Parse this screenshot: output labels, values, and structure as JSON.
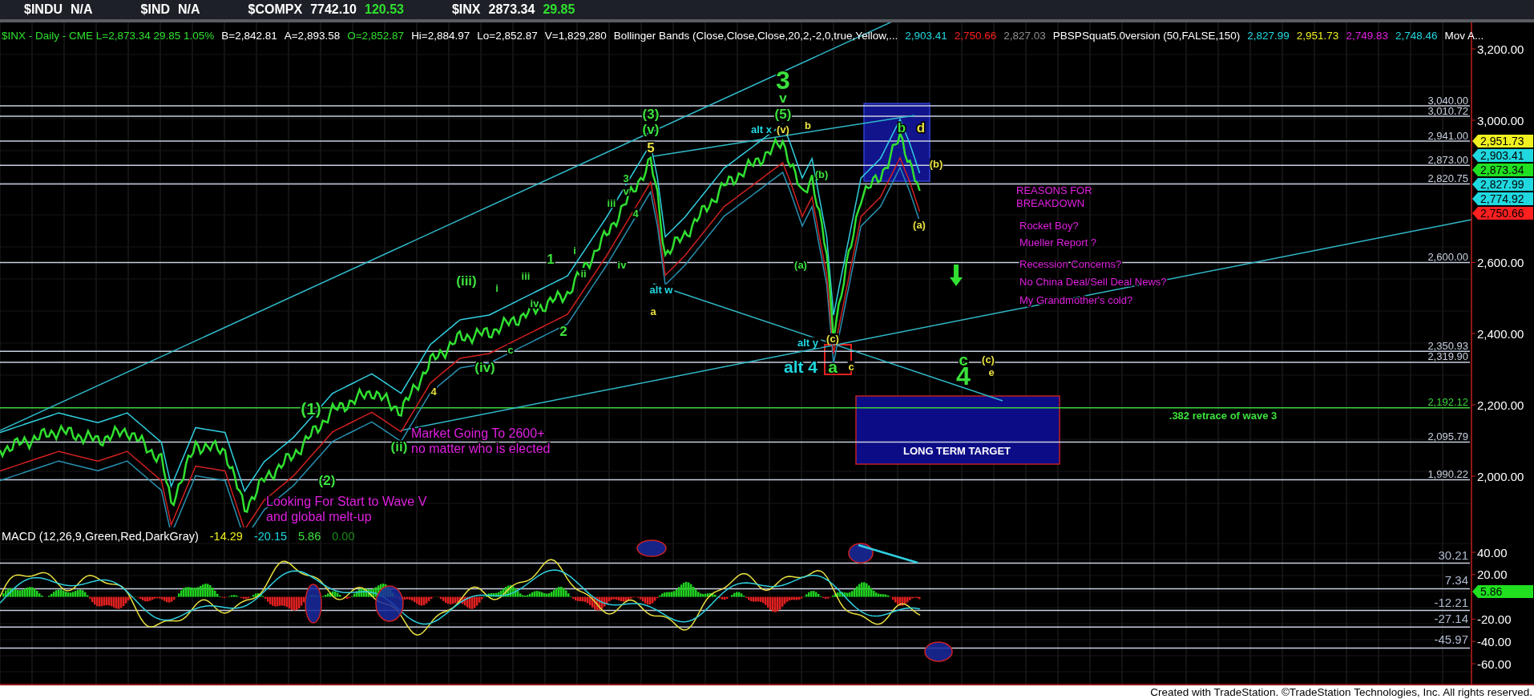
{
  "quote_strip": [
    {
      "symbol": "$INDU",
      "last": "N/A"
    },
    {
      "symbol": "$IND",
      "last": "N/A"
    },
    {
      "symbol": "$COMPX",
      "last": "7742.10",
      "change": "120.53"
    },
    {
      "symbol": "$INX",
      "last": "2873.34",
      "change": "29.85"
    }
  ],
  "price_panel": {
    "header": [
      {
        "text": "$INX - Daily - CME  L=2,873.34  29.85  1.05%",
        "color": "#2fe02f"
      },
      {
        "text": "B=2,842.81",
        "color": "#ffffff"
      },
      {
        "text": "A=2,893.58",
        "color": "#ffffff"
      },
      {
        "text": "O=2,852.87",
        "color": "#2fe02f"
      },
      {
        "text": "Hi=2,884.97",
        "color": "#ffffff"
      },
      {
        "text": "Lo=2,852.87",
        "color": "#ffffff"
      },
      {
        "text": "V=1,829,280",
        "color": "#ffffff"
      },
      {
        "text": "Bollinger Bands (Close,Close,Close,20,2,-2,0,true,Yellow,...",
        "color": "#ffffff"
      },
      {
        "text": "2,903.41",
        "color": "#20d8e0"
      },
      {
        "text": "2,750.66",
        "color": "#ff2020"
      },
      {
        "text": "2,827.03",
        "color": "#909090"
      },
      {
        "text": "PBSPSquat5.0version (50,FALSE,150)",
        "color": "#ffffff"
      },
      {
        "text": "2,827.99",
        "color": "#20d8e0"
      },
      {
        "text": "2,951.73",
        "color": "#f0f020"
      },
      {
        "text": "2,749.83",
        "color": "#e020e0"
      },
      {
        "text": "2,748.46",
        "color": "#20d8e0"
      },
      {
        "text": "Mov A...",
        "color": "#ffffff"
      }
    ],
    "axis_ticks": [
      "3,200.00",
      "3,000.00",
      "2,600.00",
      "2,400.00",
      "2,200.00",
      "2,000.00"
    ],
    "levels": [
      {
        "label": "3,040.00",
        "color": "#c8d0e0"
      },
      {
        "label": "3,010.72",
        "color": "#c8d0e0"
      },
      {
        "label": "2,941.00",
        "color": "#c8d0e0"
      },
      {
        "label": "2,873.00",
        "color": "#c8d0e0"
      },
      {
        "label": "2,820.75",
        "color": "#c8d0e0"
      },
      {
        "label": "2,600.00",
        "color": "#c8d0e0"
      },
      {
        "label": "2,350.93",
        "color": "#c8d0e0"
      },
      {
        "label": "2,319.90",
        "color": "#c8d0e0"
      },
      {
        "label": "2,192.12",
        "color": "#3cd23c"
      },
      {
        "label": "2,095.79",
        "color": "#c8d0e0"
      },
      {
        "label": "1,990.22",
        "color": "#c8d0e0"
      }
    ],
    "markers": [
      {
        "value": "2,951.73",
        "color": "#f0f020"
      },
      {
        "value": "2,903.41",
        "color": "#20d8e0"
      },
      {
        "value": "2,873.34",
        "color": "#20e020"
      },
      {
        "value": "2,827.99",
        "color": "#20d8e0"
      },
      {
        "value": "2,774.92",
        "color": "#20d8e0"
      },
      {
        "value": "2,750.66",
        "color": "#ff2020"
      }
    ],
    "annotations": [
      {
        "text": "3",
        "kind": "major",
        "color": "#3ce03c"
      },
      {
        "text": "v",
        "kind": "label",
        "color": "#3ce03c"
      },
      {
        "text": "(5)",
        "kind": "label",
        "color": "#3ce03c"
      },
      {
        "text": "(3)",
        "kind": "label",
        "color": "#3ce03c"
      },
      {
        "text": "(v)",
        "kind": "label",
        "color": "#3ce03c"
      },
      {
        "text": "5",
        "kind": "label",
        "color": "#e8e040"
      },
      {
        "text": "alt x",
        "kind": "small",
        "color": "#20d8e0"
      },
      {
        "text": "(v)",
        "kind": "small",
        "color": "#e8e040"
      },
      {
        "text": "b",
        "kind": "small",
        "color": "#e8e040"
      },
      {
        "text": "(b)",
        "kind": "small",
        "color": "#3ce03c"
      },
      {
        "text": "b",
        "kind": "label",
        "color": "#3ce03c"
      },
      {
        "text": "d",
        "kind": "label",
        "color": "#e8e040"
      },
      {
        "text": "(b)",
        "kind": "small",
        "color": "#e8e040"
      },
      {
        "text": "(a)",
        "kind": "small",
        "color": "#e8e040"
      },
      {
        "text": "(a)",
        "kind": "small",
        "color": "#3ce03c"
      },
      {
        "text": "3",
        "kind": "small",
        "color": "#3ce03c"
      },
      {
        "text": "v",
        "kind": "small",
        "color": "#3ce03c"
      },
      {
        "text": "4",
        "kind": "small",
        "color": "#3ce03c"
      },
      {
        "text": "iii",
        "kind": "small",
        "color": "#3ce03c"
      },
      {
        "text": "iv",
        "kind": "small",
        "color": "#3ce03c"
      },
      {
        "text": "alt w",
        "kind": "small",
        "color": "#20d8e0"
      },
      {
        "text": "a",
        "kind": "small",
        "color": "#e8e040"
      },
      {
        "text": "1",
        "kind": "label",
        "color": "#3ce03c"
      },
      {
        "text": "i",
        "kind": "small",
        "color": "#3ce03c"
      },
      {
        "text": "ii",
        "kind": "small",
        "color": "#3ce03c"
      },
      {
        "text": "2",
        "kind": "label",
        "color": "#3ce03c"
      },
      {
        "text": "iii",
        "kind": "small",
        "color": "#3ce03c"
      },
      {
        "text": "iv",
        "kind": "small",
        "color": "#3ce03c"
      },
      {
        "text": "i",
        "kind": "small",
        "color": "#3ce03c"
      },
      {
        "text": "c",
        "kind": "small",
        "color": "#3ce03c"
      },
      {
        "text": "(iii)",
        "kind": "label",
        "color": "#3ce03c"
      },
      {
        "text": "(iv)",
        "kind": "label",
        "color": "#3ce03c"
      },
      {
        "text": "4",
        "kind": "small",
        "color": "#e8e040"
      },
      {
        "text": "(1)",
        "kind": "medium",
        "color": "#3ce03c"
      },
      {
        "text": "(ii)",
        "kind": "label",
        "color": "#3ce03c"
      },
      {
        "text": "(2)",
        "kind": "label",
        "color": "#3ce03c"
      },
      {
        "text": "alt y",
        "kind": "small",
        "color": "#20d8e0"
      },
      {
        "text": "(c)",
        "kind": "small",
        "color": "#e8e040"
      },
      {
        "text": "alt 4",
        "kind": "medium",
        "color": "#20d8e0"
      },
      {
        "text": "a",
        "kind": "medium",
        "color": "#3ce03c"
      },
      {
        "text": "c",
        "kind": "small",
        "color": "#e8e040"
      },
      {
        "text": "c",
        "kind": "medium",
        "color": "#3ce03c"
      },
      {
        "text": "4",
        "kind": "major",
        "color": "#3ce03c"
      },
      {
        "text": "(c)",
        "kind": "small",
        "color": "#e8e040"
      },
      {
        "text": "e",
        "kind": "small",
        "color": "#e8e040"
      },
      {
        "text": ".382 retrace of wave 3",
        "kind": "small",
        "color": "#3ce03c"
      },
      {
        "text": "LONG TERM TARGET",
        "kind": "small",
        "color": "#ffffff"
      }
    ],
    "notes": [
      {
        "lines": [
          "Market Going To 2600+",
          "no matter who is elected"
        ]
      },
      {
        "lines": [
          "Looking For Start to Wave V",
          "and global melt-up"
        ]
      }
    ],
    "reasons": {
      "title": [
        "REASONS FOR",
        "BREAKDOWN"
      ],
      "items": [
        "Rocket Boy?",
        "Mueller Report ?",
        "Recession Concerns?",
        "No China Deal/Sell Deal News?",
        "My Grandmother's cold?"
      ]
    }
  },
  "macd_panel": {
    "header": [
      {
        "text": "MACD (12,26,9,Green,Red,DarkGray)",
        "color": "#ffffff"
      },
      {
        "text": "-14.29",
        "color": "#f0f020"
      },
      {
        "text": "-20.15",
        "color": "#20d8e0"
      },
      {
        "text": "5.86",
        "color": "#3ce03c"
      },
      {
        "text": "0.00",
        "color": "#1a8a1a"
      }
    ],
    "axis_ticks": [
      "40.00",
      "20.00",
      "-20.00",
      "-40.00",
      "-60.00"
    ],
    "levels": [
      "30.21",
      "7.34",
      "-12.21",
      "-27.14",
      "-45.97"
    ],
    "marker": {
      "value": "5.86",
      "color": "#20e020"
    }
  },
  "footer": "Created with TradeStation. ©TradeStation Technologies, Inc. All rights reserved."
}
